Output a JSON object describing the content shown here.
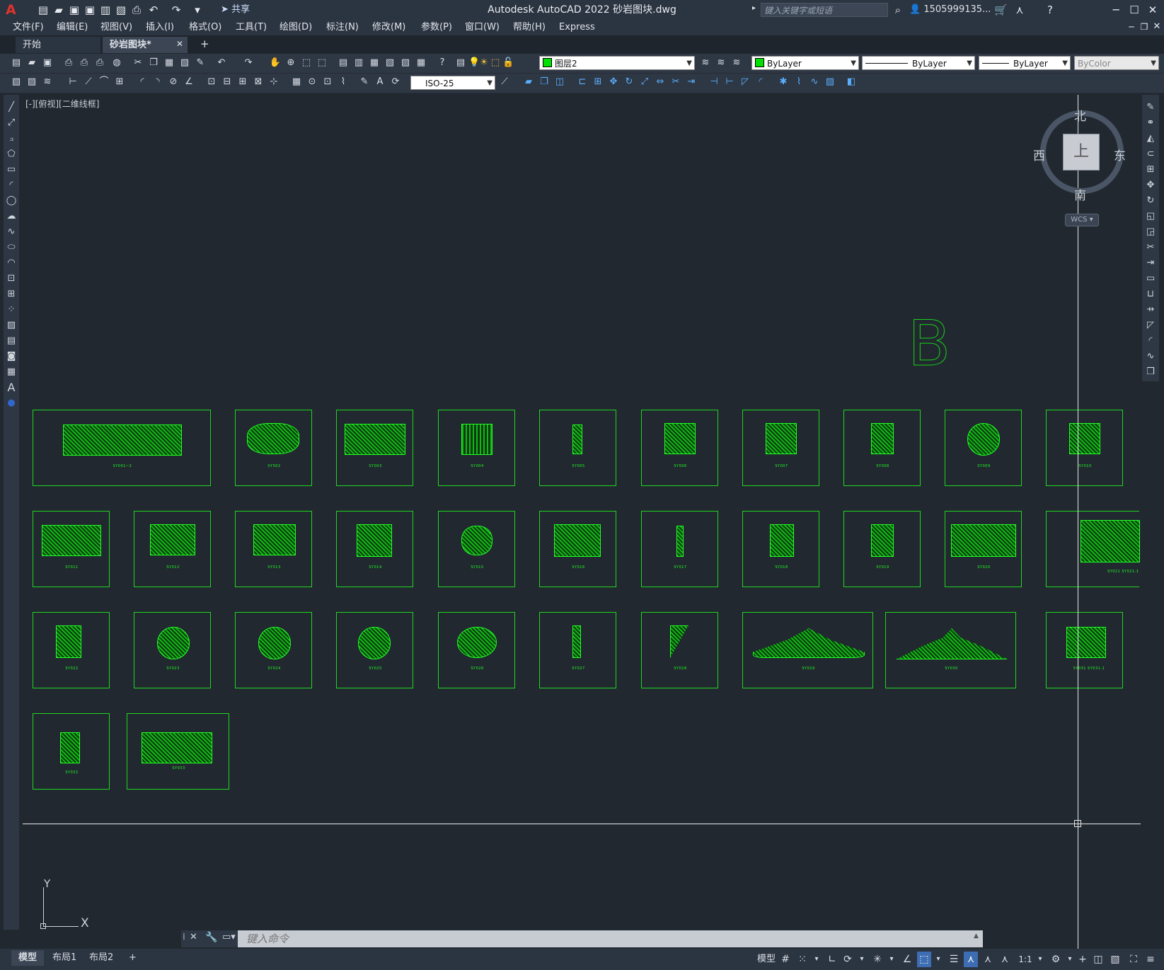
{
  "app": {
    "title": "Autodesk AutoCAD 2022    砂岩图块.dwg",
    "logo": "A",
    "share_label": "共享",
    "search_placeholder": "键入关键字或短语",
    "user": "1505999135...",
    "accent_color": "#00e000"
  },
  "menu": [
    "文件(F)",
    "编辑(E)",
    "视图(V)",
    "插入(I)",
    "格式(O)",
    "工具(T)",
    "绘图(D)",
    "标注(N)",
    "修改(M)",
    "参数(P)",
    "窗口(W)",
    "帮助(H)",
    "Express"
  ],
  "tabs": [
    {
      "label": "开始"
    },
    {
      "label": "砂岩图块*"
    }
  ],
  "toolbar": {
    "layer_name": "图层2",
    "color": "ByLayer",
    "linetype": "ByLayer",
    "lineweight": "ByLayer",
    "plotstyle": "ByColor",
    "dimstyle": "ISO-25"
  },
  "viewport": {
    "label": "[-][俯视][二维线框]",
    "big_letter": "B"
  },
  "viewcube": {
    "north": "北",
    "south": "南",
    "east": "东",
    "west": "西",
    "face": "上",
    "wcs": "WCS"
  },
  "ucs": {
    "x": "X",
    "y": "Y"
  },
  "command": {
    "placeholder": "键入命令"
  },
  "layout_tabs": [
    "模型",
    "布局1",
    "布局2"
  ],
  "status": {
    "model": "模型",
    "scale": "1:1"
  },
  "blocks": [
    {
      "id": "SY0001",
      "label": "SY001~2"
    },
    {
      "id": "SY0002",
      "label": "SY002"
    },
    {
      "id": "SY0003",
      "label": "SY003"
    },
    {
      "id": "SY0004",
      "label": "SY004"
    },
    {
      "id": "SY0005",
      "label": "SY005"
    },
    {
      "id": "SY0006",
      "label": "SY006"
    },
    {
      "id": "SY0007",
      "label": "SY007"
    },
    {
      "id": "SY0008",
      "label": "SY008"
    },
    {
      "id": "SY0009",
      "label": "SY009"
    },
    {
      "id": "SY0010",
      "label": "SY010"
    },
    {
      "id": "SY0011",
      "label": "SY011"
    },
    {
      "id": "SY0012",
      "label": "SY012"
    },
    {
      "id": "SY0013",
      "label": "SY013"
    },
    {
      "id": "SY0014",
      "label": "SY014"
    },
    {
      "id": "SY0015",
      "label": "SY015"
    },
    {
      "id": "SY0016",
      "label": "SY016"
    },
    {
      "id": "SY0017",
      "label": "SY017"
    },
    {
      "id": "SY0018",
      "label": "SY018"
    },
    {
      "id": "SY0019",
      "label": "SY019"
    },
    {
      "id": "SY0020",
      "label": "SY020"
    },
    {
      "id": "SY0021",
      "label": "SY021  SY021-1"
    },
    {
      "id": "SY0022",
      "label": "SY022"
    },
    {
      "id": "SY0023",
      "label": "SY023"
    },
    {
      "id": "SY0024",
      "label": "SY024"
    },
    {
      "id": "SY0025",
      "label": "SY025"
    },
    {
      "id": "SY0026",
      "label": "SY026"
    },
    {
      "id": "SY0027",
      "label": "SY027"
    },
    {
      "id": "SY0028",
      "label": "SY028"
    },
    {
      "id": "SY0029",
      "label": "SY029"
    },
    {
      "id": "SY0030",
      "label": "SY030"
    },
    {
      "id": "SY0031",
      "label": "SY031  SY031-1"
    },
    {
      "id": "SY0032",
      "label": "SY032"
    },
    {
      "id": "SY0033",
      "label": "SY033"
    }
  ]
}
